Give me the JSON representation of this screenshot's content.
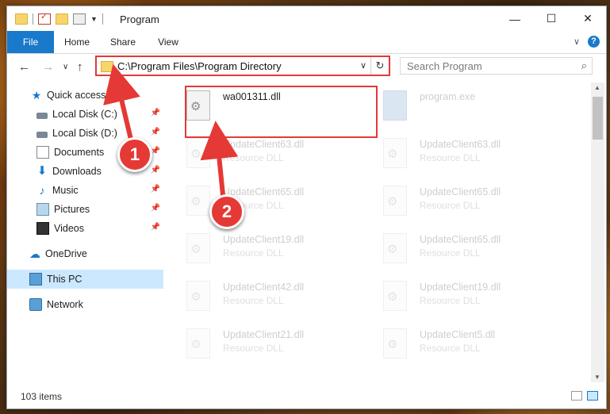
{
  "window": {
    "title": "Program",
    "controls": {
      "minimize": "—",
      "maximize": "☐",
      "close": "✕"
    }
  },
  "ribbon": {
    "tabs": [
      "File",
      "Home",
      "Share",
      "View"
    ],
    "expand_glyph": "∨",
    "help_glyph": "?"
  },
  "nav": {
    "back": "←",
    "forward": "→",
    "recent": "∨",
    "up": "↑",
    "address": "C:\\Program Files\\Program Directory",
    "address_dropdown": "∨",
    "refresh": "↻",
    "search_placeholder": "Search Program",
    "search_icon": "magnifier-icon"
  },
  "sidebar": {
    "items": [
      {
        "label": "Quick access",
        "icon": "star-icon",
        "pinned": false
      },
      {
        "label": "Local Disk (C:)",
        "icon": "drive-icon",
        "pinned": true
      },
      {
        "label": "Local Disk (D:)",
        "icon": "drive-icon",
        "pinned": true
      },
      {
        "label": "Documents",
        "icon": "documents-icon",
        "pinned": true
      },
      {
        "label": "Downloads",
        "icon": "download-icon",
        "pinned": true
      },
      {
        "label": "Music",
        "icon": "music-icon",
        "pinned": true
      },
      {
        "label": "Pictures",
        "icon": "pictures-icon",
        "pinned": true
      },
      {
        "label": "Videos",
        "icon": "videos-icon",
        "pinned": true
      },
      {
        "label": "OneDrive",
        "icon": "cloud-icon",
        "pinned": false
      },
      {
        "label": "This PC",
        "icon": "computer-icon",
        "pinned": false,
        "selected": true
      },
      {
        "label": "Network",
        "icon": "network-icon",
        "pinned": false
      }
    ],
    "pin_glyph": "📌"
  },
  "files": [
    {
      "name": "wa001311.dll",
      "type": "",
      "highlighted": true
    },
    {
      "name": "program.exe",
      "type": "",
      "faded": true
    },
    {
      "name": "UpdateClient63.dll",
      "type": "Resource DLL",
      "faded": true
    },
    {
      "name": "UpdateClient63.dll",
      "type": "Resource DLL",
      "faded": true
    },
    {
      "name": "UpdateClient65.dll",
      "type": "Resource DLL",
      "faded": true
    },
    {
      "name": "UpdateClient65.dll",
      "type": "Resource DLL",
      "faded": true
    },
    {
      "name": "UpdateClient19.dll",
      "type": "Resource DLL",
      "faded": true
    },
    {
      "name": "UpdateClient65.dll",
      "type": "Resource DLL",
      "faded": true
    },
    {
      "name": "UpdateClient42.dll",
      "type": "Resource DLL",
      "faded": true
    },
    {
      "name": "UpdateClient19.dll",
      "type": "Resource DLL",
      "faded": true
    },
    {
      "name": "UpdateClient21.dll",
      "type": "Resource DLL",
      "faded": true
    },
    {
      "name": "UpdateClient5.dll",
      "type": "Resource DLL",
      "faded": true
    }
  ],
  "scrollbar": {
    "up": "▲",
    "down": "▼"
  },
  "status": {
    "item_count": "103 items"
  },
  "annotations": {
    "step1": "1",
    "step2": "2"
  },
  "colors": {
    "accent": "#1979ca",
    "annotation": "#e53935",
    "selection": "#cce8ff"
  }
}
